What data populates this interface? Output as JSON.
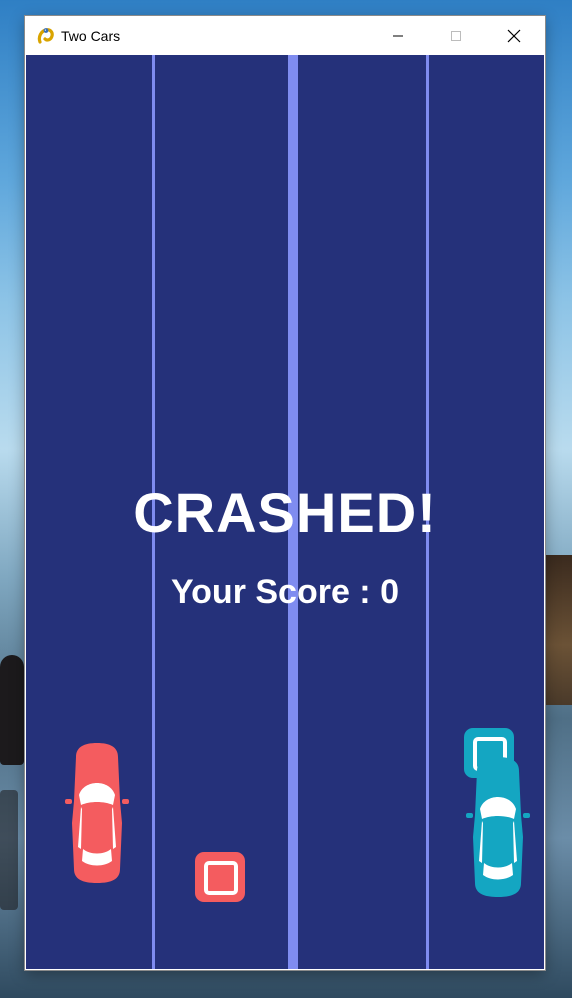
{
  "window": {
    "title": "Two Cars",
    "icon": "pygame-snake-icon"
  },
  "game": {
    "background_color": "#25317a",
    "lane_line_color": "#7f8cf0",
    "message": "CRASHED!",
    "score_text": "Your Score : 0",
    "left_car_color": "#f45c5f",
    "right_car_color": "#14a6c2",
    "left_obstacle_color": "#f45c5f",
    "right_obstacle_color": "#14a6c2"
  }
}
